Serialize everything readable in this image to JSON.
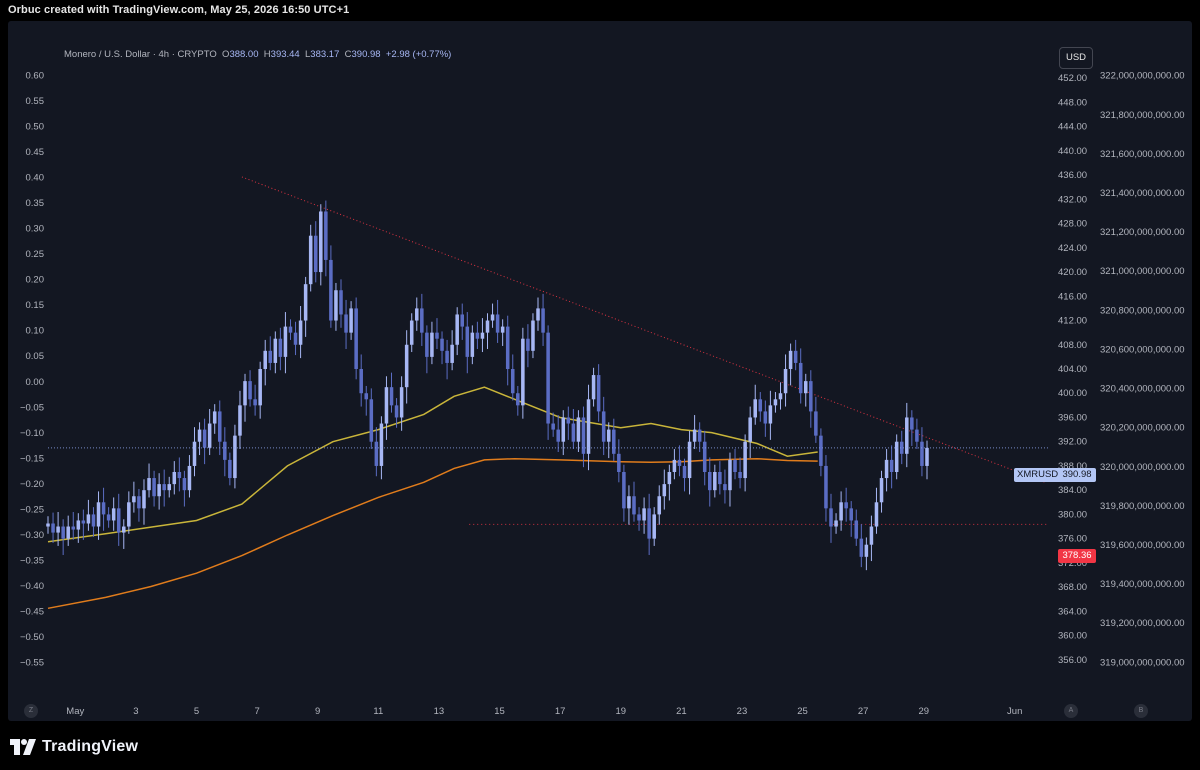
{
  "header": {
    "credit": "Orbuc created with TradingView.com, May 25, 2026 16:50 UTC+1"
  },
  "legend": {
    "symbol": "Monero / U.S. Dollar · 4h · CRYPTO",
    "o_label": "O",
    "o": "388.00",
    "h_label": "H",
    "h": "393.44",
    "l_label": "L",
    "l": "383.17",
    "c_label": "C",
    "c": "390.98",
    "change": "+2.98 (+0.77%)"
  },
  "currency_button": "USD",
  "price_tags": {
    "symbol": "XMRUSD",
    "last": "390.98",
    "level": "378.36"
  },
  "branding": {
    "logo_text": "TradingView"
  },
  "bottom_buttons": {
    "auto": "A",
    "log": "B",
    "zoom": "Z"
  },
  "colors": {
    "up": "#a7b7f4",
    "down": "#5b6dc4",
    "ema_fast": "#c9b53a",
    "ema_slow": "#e07c1c",
    "trendline": "#f23645",
    "last_price_line": "#8fa6f0"
  },
  "chart_data": {
    "type": "candlestick",
    "symbol": "XMRUSD",
    "timeframe": "4h",
    "x_tick_labels": [
      "May",
      "3",
      "5",
      "7",
      "9",
      "11",
      "13",
      "15",
      "17",
      "19",
      "21",
      "23",
      "25",
      "27",
      "29",
      "Jun"
    ],
    "x_tick_days": [
      1,
      3,
      5,
      7,
      9,
      11,
      13,
      15,
      17,
      19,
      21,
      23,
      25,
      27,
      29,
      32
    ],
    "xlim_days": [
      0.1,
      33
    ],
    "price_axis": {
      "label": "USD",
      "ylim": [
        353,
        455
      ],
      "ticks": [
        356,
        360,
        364,
        368,
        372,
        376,
        380,
        384,
        388,
        392,
        396,
        400,
        404,
        408,
        412,
        416,
        420,
        424,
        428,
        432,
        436,
        440,
        444,
        448,
        452
      ]
    },
    "left_axis": {
      "ylim": [
        -0.58,
        0.63
      ],
      "ticks": [
        0.6,
        0.55,
        0.5,
        0.45,
        0.4,
        0.35,
        0.3,
        0.25,
        0.2,
        0.15,
        0.1,
        0.05,
        0.0,
        -0.05,
        -0.1,
        -0.15,
        -0.2,
        -0.25,
        -0.3,
        -0.35,
        -0.4,
        -0.45,
        -0.5,
        -0.55
      ]
    },
    "far_right_axis": {
      "ylim": [
        318920000000,
        322080000000
      ],
      "ticks": [
        319000000000,
        319200000000,
        319400000000,
        319600000000,
        319800000000,
        320000000000,
        320200000000,
        320400000000,
        320600000000,
        320800000000,
        321000000000,
        321200000000,
        321400000000,
        321600000000,
        321800000000,
        322000000000
      ]
    },
    "series_close": [
      {
        "start_day": 0.1,
        "step_days": 0.1667,
        "values": [
          378.5,
          377,
          378,
          376,
          378,
          377.5,
          379,
          378.5,
          380,
          378,
          382,
          380,
          379,
          381,
          377,
          378,
          382,
          383,
          381,
          384,
          386,
          383,
          385,
          384,
          385,
          387,
          386,
          384,
          388,
          392,
          394,
          391,
          395,
          397,
          392,
          389,
          386,
          393,
          398,
          402,
          399,
          398,
          404,
          407,
          405,
          409,
          406,
          411,
          410,
          408,
          412,
          418,
          426,
          420,
          430,
          422,
          412,
          417,
          413,
          410,
          414,
          404,
          400,
          399,
          392,
          388,
          395,
          401,
          398,
          396,
          401,
          408,
          412,
          414,
          410,
          406,
          410,
          409,
          407,
          405,
          408,
          413,
          411,
          406,
          410,
          409,
          410,
          412,
          413,
          410,
          411,
          404,
          400,
          398,
          409,
          407,
          412,
          414,
          410,
          395,
          394,
          392,
          396,
          395,
          392,
          396,
          390,
          399,
          403,
          397,
          392,
          394,
          390,
          387,
          381,
          383,
          380,
          379,
          381,
          376,
          380,
          383,
          385,
          387,
          389,
          388,
          386,
          392,
          394,
          392,
          387,
          384,
          387,
          385,
          384,
          389,
          387,
          386,
          392,
          396,
          399,
          397,
          395,
          398,
          399,
          400,
          404,
          407,
          405,
          400,
          402,
          397,
          393,
          388,
          381,
          378,
          379,
          382,
          381,
          379,
          376,
          373,
          375,
          378,
          382,
          386,
          389,
          387,
          392,
          390,
          396,
          394,
          392,
          388,
          390.98
        ]
      }
    ],
    "ema_fast_values": [
      375.5,
      376.8,
      377.9,
      379.0,
      381.7,
      388.0,
      392.0,
      394.0,
      396.5,
      399.5,
      401.0,
      399.0,
      396.0,
      394.3,
      395.0,
      394.0,
      393.5,
      391.7,
      389.6,
      390.3
    ],
    "ema_slow_values": [
      364.5,
      366.3,
      368.1,
      370.3,
      373.2,
      376.6,
      379.8,
      382.8,
      385.3,
      387.6,
      389.0,
      389.2,
      389.0,
      388.7,
      388.6,
      388.7,
      389.0,
      389.2,
      388.9,
      388.8
    ],
    "ema_days": [
      0.1,
      2,
      3.5,
      5,
      6.5,
      8,
      9.5,
      11,
      12.5,
      13.5,
      14.5,
      15.5,
      17,
      19,
      20,
      21,
      22,
      23.5,
      24.5,
      25.5
    ],
    "trendline": {
      "from": {
        "day": 6.5,
        "price": 435.7
      },
      "to": {
        "day": 33,
        "price": 385.3
      }
    },
    "horizontal_level": {
      "price": 378.36,
      "from_day": 14
    }
  }
}
